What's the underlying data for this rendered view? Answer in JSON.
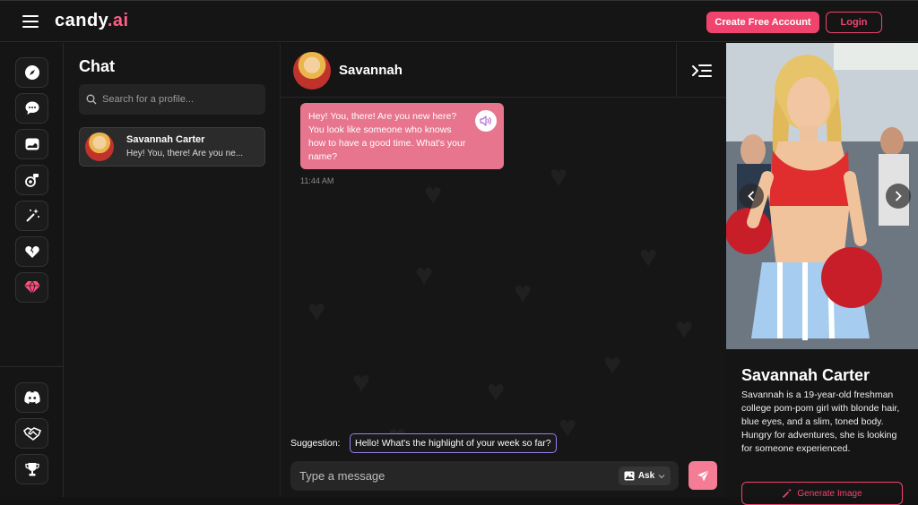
{
  "header": {
    "logo_text": "candy",
    "logo_suffix": ".ai",
    "create_account_label": "Create Free Account",
    "login_label": "Login"
  },
  "rail": {
    "icons": [
      "compass-icon",
      "chat-bubble-icon",
      "image-gallery-icon",
      "role-play-icon",
      "magic-wand-icon",
      "broken-heart-icon",
      "gem-icon"
    ],
    "bottom_icons": [
      "discord-icon",
      "affiliate-handshake-icon",
      "trophy-icon"
    ],
    "accent": "#ff4f80"
  },
  "chat_list": {
    "title": "Chat",
    "search_placeholder": "Search for a profile...",
    "items": [
      {
        "name": "Savannah Carter",
        "preview": "Hey! You, there! Are you ne..."
      }
    ]
  },
  "conversation": {
    "name": "Savannah",
    "messages": [
      {
        "text": "Hey! You, there! Are you new here? You look like someone who knows how to have a good time. What's your name?",
        "time": "11:44 AM"
      }
    ],
    "suggestion_label": "Suggestion:",
    "suggestion_text": "Hello! What's the highlight of your week so far?",
    "input_placeholder": "Type a message",
    "ask_label": "Ask"
  },
  "profile": {
    "name": "Savannah Carter",
    "bio": "Savannah is a 19-year-old freshman college pom-pom girl with blonde hair, blue eyes, and a slim, toned body. Hungry for adventures, she is looking for someone experienced.",
    "generate_label": "Generate Image"
  },
  "colors": {
    "brand_pink": "#f0446e",
    "bubble_pink": "#e7758e",
    "suggestion_border": "#9b7cf0"
  }
}
